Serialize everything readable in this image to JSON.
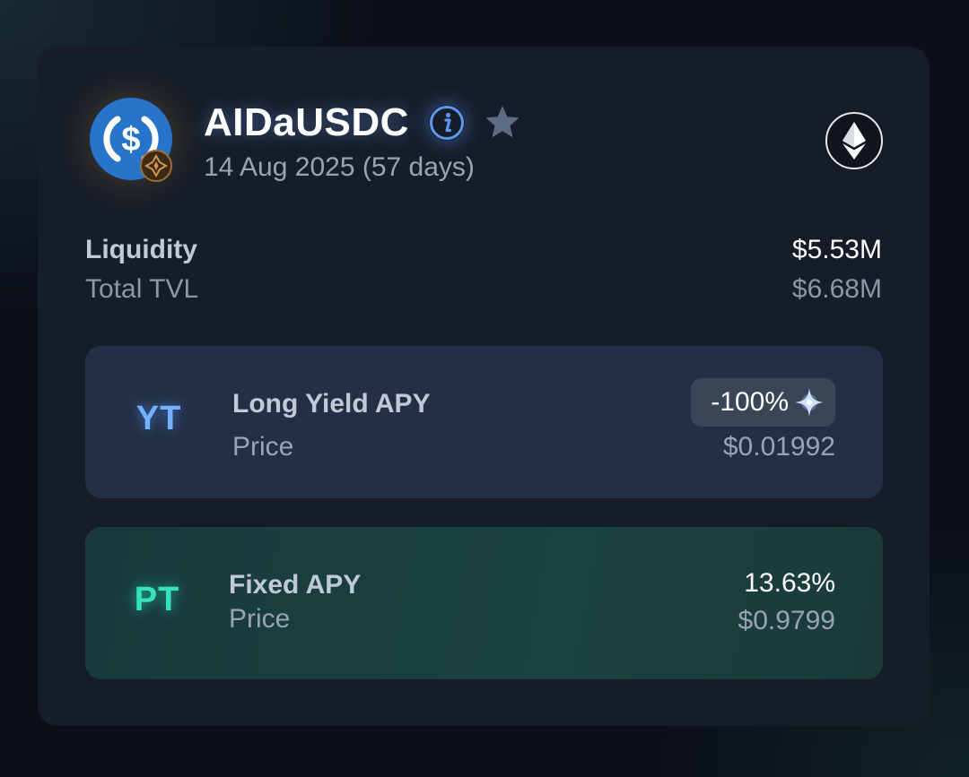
{
  "pool": {
    "name": "AIDaUSDC",
    "maturity": "14 Aug 2025 (57 days)",
    "underlying_icon": "usdc-icon",
    "protocol_badge_icon": "protocol-badge-icon",
    "chain_icon": "ethereum-icon"
  },
  "stats": {
    "liquidity_label": "Liquidity",
    "liquidity_value": "$5.53M",
    "tvl_label": "Total TVL",
    "tvl_value": "$6.68M"
  },
  "markets": {
    "yt": {
      "tag": "YT",
      "apy_label": "Long Yield APY",
      "apy_value": "-100%",
      "price_label": "Price",
      "price_value": "$0.01992"
    },
    "pt": {
      "tag": "PT",
      "apy_label": "Fixed APY",
      "apy_value": "13.63%",
      "price_label": "Price",
      "price_value": "$0.9799"
    }
  },
  "colors": {
    "background": "#0b0f1a",
    "card": "#161d29",
    "yt_card": "#232f44",
    "pt_card": "#1b4140",
    "yt_accent": "#74b1ff",
    "pt_accent": "#34e3bd",
    "usdc_blue": "#2775ca"
  }
}
